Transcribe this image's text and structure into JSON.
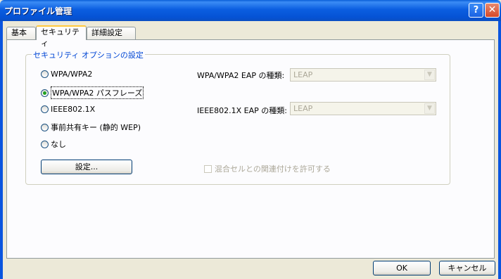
{
  "window": {
    "title": "プロファイル管理",
    "help_glyph": "?",
    "close_glyph": "✕"
  },
  "tabs": [
    {
      "label": "基本"
    },
    {
      "label": "セキュリティ"
    },
    {
      "label": "詳細設定"
    }
  ],
  "security": {
    "group_title": "セキュリティ オプションの設定",
    "options": [
      {
        "label": "WPA/WPA2",
        "checked": false
      },
      {
        "label": "WPA/WPA2 パスフレーズ",
        "checked": true
      },
      {
        "label": "IEEE802.1X",
        "checked": false
      },
      {
        "label": "事前共有キー (静的 WEP)",
        "checked": false
      },
      {
        "label": "なし",
        "checked": false
      }
    ],
    "wpa_eap_label": "WPA/WPA2 EAP の種類:",
    "wpa_eap_value": "LEAP",
    "ieee_eap_label": "IEEE802.1X EAP の種類:",
    "ieee_eap_value": "LEAP",
    "settings_button": "設定...",
    "mixed_cell_label": "混合セルとの関連付けを許可する"
  },
  "footer": {
    "ok_label": "OK",
    "cancel_label": "キャンセル"
  }
}
